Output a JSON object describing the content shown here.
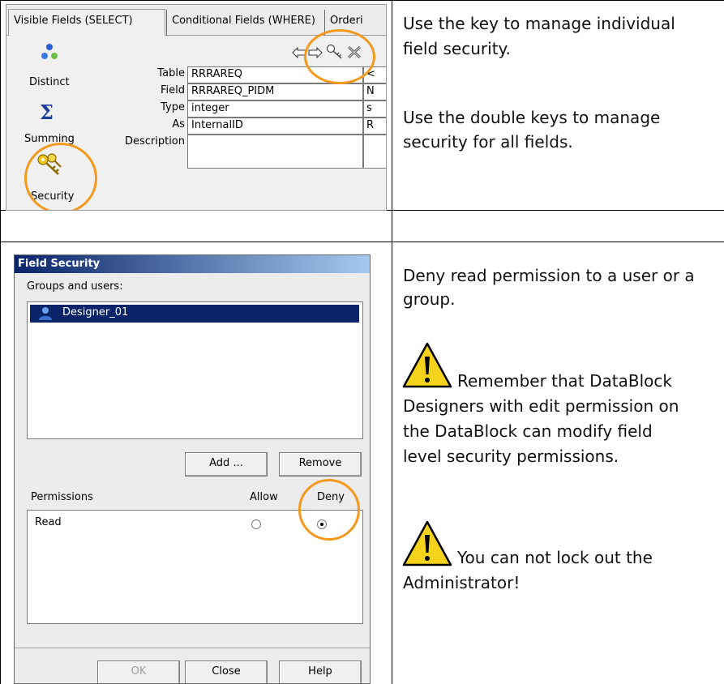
{
  "top_screenshot": {
    "tabs": [
      "Visible Fields (SELECT)",
      "Conditional Fields (WHERE)",
      "Orderi"
    ],
    "toolbar_icons": [
      "arrow-left-icon",
      "arrow-right-icon",
      "key-icon",
      "double-key-icon"
    ],
    "sidebar": [
      {
        "label": "Distinct",
        "icon": "distinct-icon"
      },
      {
        "label": "Summing",
        "icon": "sigma-icon"
      },
      {
        "label": "Security",
        "icon": "keys-icon"
      }
    ],
    "fields": [
      {
        "label": "Table",
        "value": "RRRAREQ",
        "extra": "<"
      },
      {
        "label": "Field",
        "value": "RRRAREQ_PIDM",
        "extra": "N"
      },
      {
        "label": "Type",
        "value": "integer",
        "extra": "s"
      },
      {
        "label": "As",
        "value": "InternalID",
        "extra": "R"
      },
      {
        "label": "Description",
        "value": "",
        "extra": ""
      }
    ]
  },
  "dialog": {
    "title": "Field Security",
    "groups_label": "Groups and users:",
    "selected_user": "Designer_01",
    "add_button": "Add ...",
    "remove_button": "Remove",
    "permissions_label": "Permissions",
    "allow_label": "Allow",
    "deny_label": "Deny",
    "permission_row": "Read",
    "permission_selected": "Deny",
    "ok_button": "OK",
    "close_button": "Close",
    "help_button": "Help"
  },
  "notes": {
    "row1_a": [
      "Use the key to manage individual",
      "field security."
    ],
    "row1_b": [
      "Use the double keys to manage",
      "security for all fields."
    ],
    "row3_a": [
      "Deny read permission to a user or a",
      "group."
    ],
    "row3_warn1": [
      "Remember that DataBlock",
      "Designers with edit permission on",
      "the DataBlock can modify field",
      "level security permissions."
    ],
    "row3_warn2": [
      "You can not lock out the",
      "Administrator!"
    ]
  },
  "colors": {
    "highlight": "#f39a1e",
    "title_bar": "#0a246a",
    "warning_yellow": "#f5d31d"
  }
}
